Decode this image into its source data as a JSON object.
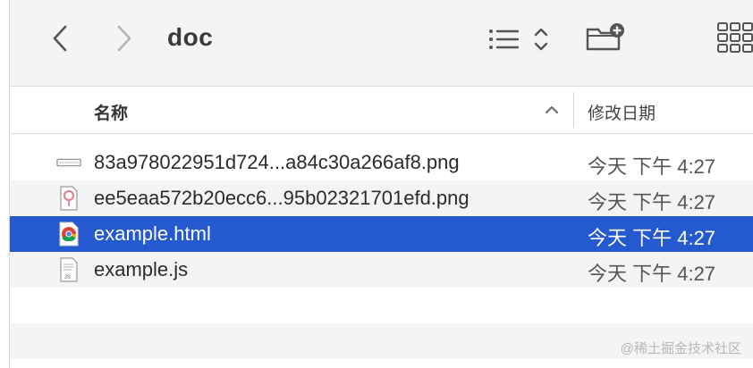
{
  "toolbar": {
    "back_icon": "chevron-left-icon",
    "forward_icon": "chevron-right-icon",
    "folder_title": "doc",
    "view_icon": "list-view-icon",
    "new_folder_icon": "new-folder-icon",
    "more_icon": "icon-grid-icon"
  },
  "columns": {
    "name": "名称",
    "date": "修改日期",
    "sort_direction": "ascending"
  },
  "files": [
    {
      "name": "83a978022951d724...a84c30a266af8.png",
      "date": "今天 下午 4:27",
      "icon": "png-file-icon",
      "selected": false
    },
    {
      "name": "ee5eaa572b20ecc6...95b02321701efd.png",
      "date": "今天 下午 4:27",
      "icon": "png-image-icon",
      "selected": false
    },
    {
      "name": "example.html",
      "date": "今天 下午 4:27",
      "icon": "chrome-html-icon",
      "selected": true
    },
    {
      "name": "example.js",
      "date": "今天 下午 4:27",
      "icon": "js-file-icon",
      "selected": false
    }
  ],
  "watermark": "@稀土掘金技术社区",
  "colors": {
    "selection": "#2459cf",
    "toolbar_bg": "#f5f3f5",
    "alt_row": "#f4f4f4"
  }
}
